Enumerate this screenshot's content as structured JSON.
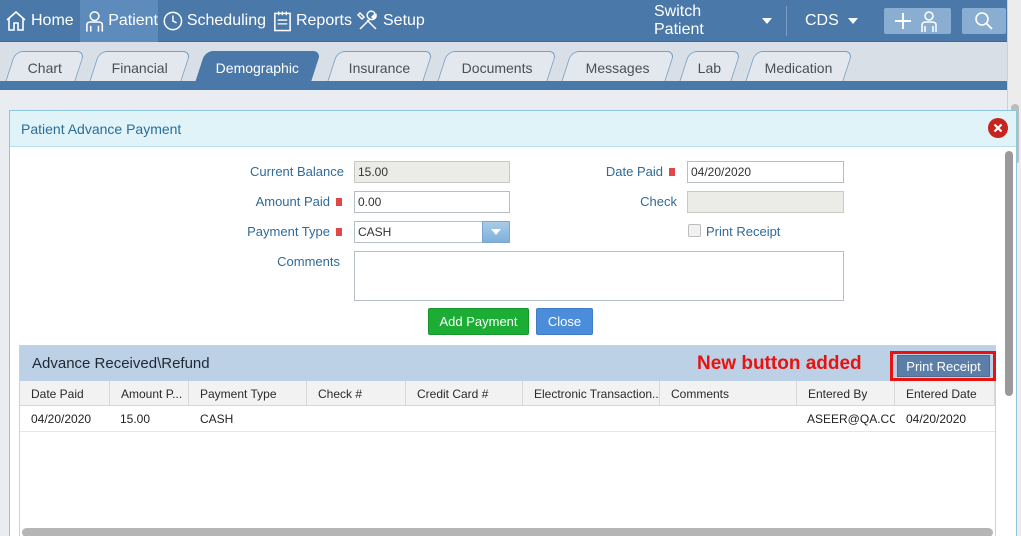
{
  "nav": {
    "home": "Home",
    "patient": "Patient",
    "scheduling": "Scheduling",
    "reports": "Reports",
    "setup": "Setup",
    "switch_patient": "Switch Patient",
    "cds": "CDS"
  },
  "tabs": [
    {
      "label": "Chart"
    },
    {
      "label": "Financial"
    },
    {
      "label": "Demographic",
      "active": true
    },
    {
      "label": "Insurance"
    },
    {
      "label": "Documents"
    },
    {
      "label": "Messages"
    },
    {
      "label": "Lab"
    },
    {
      "label": "Medication"
    }
  ],
  "dialog": {
    "title": "Patient Advance Payment",
    "form": {
      "current_balance_label": "Current Balance",
      "current_balance": "15.00",
      "amount_paid_label": "Amount Paid",
      "amount_paid": "0.00",
      "payment_type_label": "Payment Type",
      "payment_type": "CASH",
      "comments_label": "Comments",
      "comments": "",
      "date_paid_label": "Date Paid",
      "date_paid": "04/20/2020",
      "check_label": "Check",
      "check": "",
      "print_receipt_label": "Print Receipt",
      "print_receipt_checked": false
    },
    "buttons": {
      "add_payment": "Add Payment",
      "close": "Close"
    },
    "grid": {
      "title": "Advance Received\\Refund",
      "annotation": "New button added",
      "print_receipt_button": "Print Receipt",
      "columns": [
        "Date Paid",
        "Amount P...",
        "Payment Type",
        "Check #",
        "Credit Card #",
        "Electronic Transaction...",
        "Comments",
        "Entered By",
        "Entered Date"
      ],
      "rows": [
        [
          "04/20/2020",
          "15.00",
          "CASH",
          "",
          "",
          "",
          "",
          "ASEER@QA.CO...",
          "04/20/2020"
        ]
      ]
    }
  },
  "colors": {
    "nav_bg": "#4a78a8",
    "add_payment": "#1cae34",
    "close": "#4c8ddb",
    "annotation": "#e8130f"
  }
}
